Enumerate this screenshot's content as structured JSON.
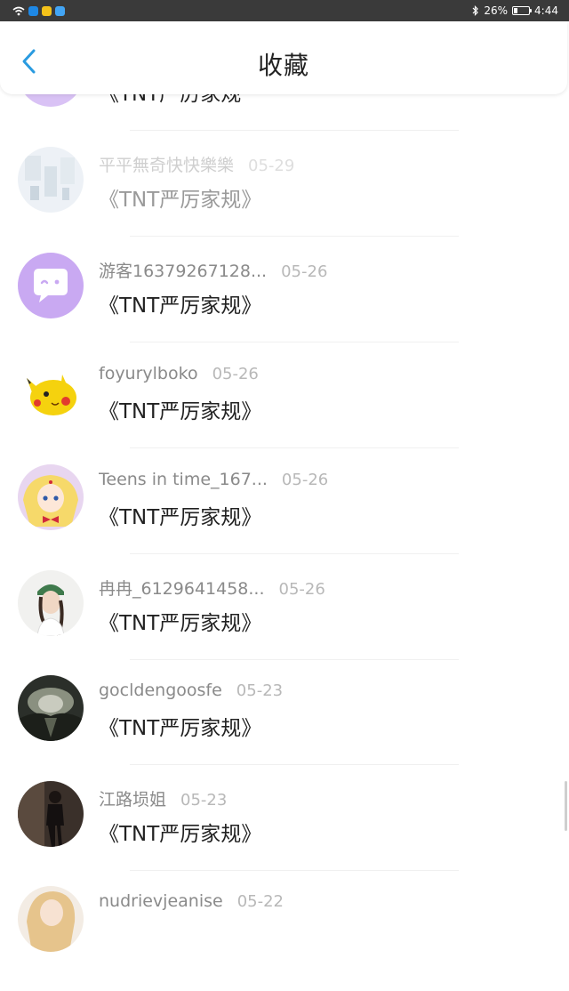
{
  "status_bar": {
    "battery_percent": "26%",
    "time": "4:44",
    "battery_level": 0.26,
    "app_icon_colors": [
      "#1e88e5",
      "#f4c21a",
      "#42a5f5"
    ]
  },
  "header": {
    "title": "收藏",
    "back_icon": "chevron-left-icon",
    "back_color": "#2a9be0"
  },
  "items": [
    {
      "name": "",
      "date": "",
      "work": "《TNT严厉家规",
      "avatar": "avatar-purple-partial"
    },
    {
      "name": "平平無奇快快樂樂",
      "date": "05-29",
      "work": "《TNT严厉家规》",
      "avatar": "avatar-photo-blue-white"
    },
    {
      "name": "游客16379267128...",
      "date": "05-26",
      "work": "《TNT严厉家规》",
      "avatar": "avatar-default-chat-bubble"
    },
    {
      "name": "foyurylboko",
      "date": "05-26",
      "work": "《TNT严厉家规》",
      "avatar": "avatar-pikachu"
    },
    {
      "name": "Teens in time_167...",
      "date": "05-26",
      "work": "《TNT严厉家规》",
      "avatar": "avatar-sailor-moon"
    },
    {
      "name": "冉冉_6129641458...",
      "date": "05-26",
      "work": "《TNT严厉家规》",
      "avatar": "avatar-girl-green-cap"
    },
    {
      "name": "gocldengoosfe",
      "date": "05-23",
      "work": "《TNT严厉家规》",
      "avatar": "avatar-dark-landscape"
    },
    {
      "name": "江路埙姐",
      "date": "05-23",
      "work": "《TNT严厉家规》",
      "avatar": "avatar-dark-figure"
    },
    {
      "name": "nudrievjeanise",
      "date": "05-22",
      "work": "",
      "avatar": "avatar-blonde-person"
    }
  ],
  "colors": {
    "accent": "#2a9be0",
    "default_avatar_bg": "#c9a9f2"
  }
}
